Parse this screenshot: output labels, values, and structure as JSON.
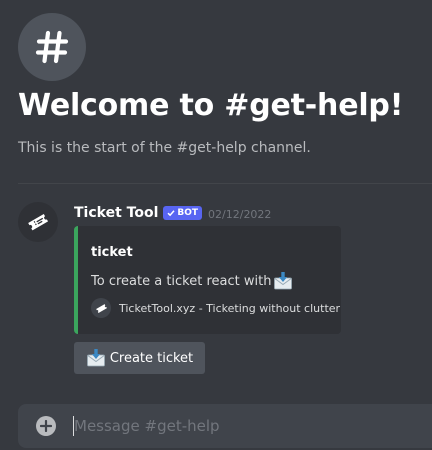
{
  "channel": {
    "icon": "hash-icon",
    "welcome_title": "Welcome to #get-help!",
    "welcome_subtitle": "This is the start of the #get-help channel."
  },
  "message": {
    "avatar_icon": "ticket-icon",
    "username": "Ticket Tool",
    "bot_badge": "BOT",
    "timestamp": "02/12/2022",
    "embed": {
      "accent_color": "#3ba55d",
      "title": "ticket",
      "description": "To create a ticket react with",
      "description_emoji": "envelope-with-arrow-icon",
      "footer_icon": "ticket-icon",
      "footer_text": "TicketTool.xyz - Ticketing without clutter"
    },
    "button": {
      "icon": "envelope-with-arrow-icon",
      "label": "Create ticket"
    }
  },
  "composer": {
    "attach_icon": "plus-circle-icon",
    "placeholder": "Message #get-help"
  },
  "colors": {
    "background": "#36393f",
    "embed_background": "#2f3136",
    "bot_badge": "#5865f2",
    "button": "#4f545c",
    "composer": "#40444b"
  }
}
